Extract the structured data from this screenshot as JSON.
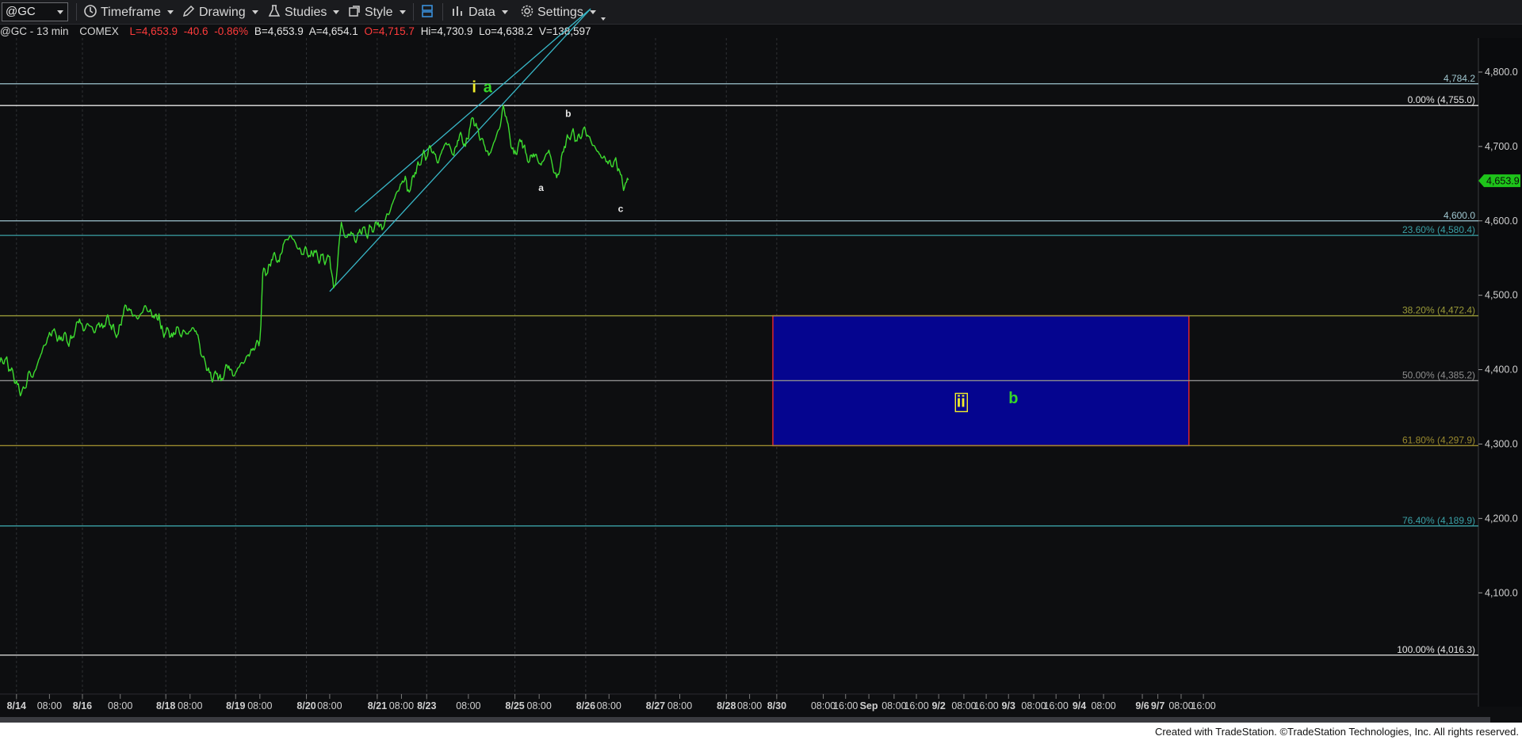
{
  "toolbar": {
    "symbol": "@GC",
    "timeframe_label": "Timeframe",
    "drawing_label": "Drawing",
    "studies_label": "Studies",
    "style_label": "Style",
    "data_label": "Data",
    "settings_label": "Settings"
  },
  "infobar": {
    "symbol_interval": "@GC - 13 min",
    "exchange": "COMEX",
    "last": "L=4,653.9",
    "change": "-40.6",
    "change_pct": "-0.86%",
    "bid": "B=4,653.9",
    "ask": "A=4,654.1",
    "open": "O=4,715.7",
    "high": "Hi=4,730.9",
    "low": "Lo=4,638.2",
    "volume": "V=138,597"
  },
  "footer": {
    "credit": "Created with TradeStation. ©TradeStation Technologies, Inc. All rights reserved."
  },
  "colors": {
    "background": "#0d0e10",
    "price_line": "#3ddc2f",
    "channel": "#38b8c8",
    "target_box_fill": "#05058f",
    "target_box_border": "#d0242f",
    "wave_yellow": "#f2ef2a",
    "wave_green": "#35d629"
  },
  "chart_data": {
    "type": "line",
    "title": "",
    "symbol": "@GC",
    "interval": "13 min",
    "ylim": [
      4000,
      4850
    ],
    "y_ticks": [
      "4,100.0",
      "4,200.0",
      "4,300.0",
      "4,400.0",
      "4,500.0",
      "4,600.0",
      "4,700.0",
      "4,800.0"
    ],
    "y_tick_values": [
      4100,
      4200,
      4300,
      4400,
      4500,
      4600,
      4700,
      4800
    ],
    "x_index_range": [
      0,
      1000
    ],
    "x_tick_labels": [
      {
        "i": 17,
        "label": "8/14"
      },
      {
        "i": 51,
        "label": "08:00"
      },
      {
        "i": 85,
        "label": "8/16"
      },
      {
        "i": 124,
        "label": "08:00"
      },
      {
        "i": 171,
        "label": "8/18"
      },
      {
        "i": 196,
        "label": "08:00"
      },
      {
        "i": 243,
        "label": "8/19"
      },
      {
        "i": 268,
        "label": "08:00"
      },
      {
        "i": 316,
        "label": "8/20"
      },
      {
        "i": 340,
        "label": "08:00"
      },
      {
        "i": 389,
        "label": "8/21"
      },
      {
        "i": 414,
        "label": "08:00"
      },
      {
        "i": 440,
        "label": "8/23"
      },
      {
        "i": 483,
        "label": "08:00"
      },
      {
        "i": 531,
        "label": "8/25"
      },
      {
        "i": 556,
        "label": "08:00"
      },
      {
        "i": 604,
        "label": "8/26"
      },
      {
        "i": 628,
        "label": "08:00"
      },
      {
        "i": 676,
        "label": "8/27"
      },
      {
        "i": 701,
        "label": "08:00"
      },
      {
        "i": 749,
        "label": "8/28"
      },
      {
        "i": 773,
        "label": "08:00"
      },
      {
        "i": 801,
        "label": "8/30"
      },
      {
        "i": 849,
        "label": "08:00"
      },
      {
        "i": 872,
        "label": "16:00"
      },
      {
        "i": 896,
        "label": "Sep"
      },
      {
        "i": 922,
        "label": "08:00"
      },
      {
        "i": 945,
        "label": "16:00"
      },
      {
        "i": 968,
        "label": "9/2"
      },
      {
        "i": 994,
        "label": "08:00"
      },
      {
        "i": 1017,
        "label": "16:00"
      },
      {
        "i": 1040,
        "label": "9/3"
      },
      {
        "i": 1066,
        "label": "08:00"
      },
      {
        "i": 1089,
        "label": "16:00"
      },
      {
        "i": 1113,
        "label": "9/4"
      },
      {
        "i": 1138,
        "label": "08:00"
      },
      {
        "i": 1178,
        "label": "9/6"
      },
      {
        "i": 1194,
        "label": "9/7"
      },
      {
        "i": 1218,
        "label": "08:00"
      },
      {
        "i": 1241,
        "label": "16:00"
      }
    ],
    "series": [
      {
        "values": [
          [
            0,
            4410
          ],
          [
            6,
            4415
          ],
          [
            10,
            4400
          ],
          [
            14,
            4392
          ],
          [
            18,
            4380
          ],
          [
            22,
            4368
          ],
          [
            26,
            4375
          ],
          [
            30,
            4398
          ],
          [
            34,
            4390
          ],
          [
            38,
            4405
          ],
          [
            42,
            4420
          ],
          [
            46,
            4433
          ],
          [
            50,
            4445
          ],
          [
            54,
            4452
          ],
          [
            58,
            4446
          ],
          [
            62,
            4440
          ],
          [
            66,
            4448
          ],
          [
            70,
            4435
          ],
          [
            74,
            4442
          ],
          [
            78,
            4456
          ],
          [
            82,
            4468
          ],
          [
            86,
            4452
          ],
          [
            90,
            4462
          ],
          [
            94,
            4458
          ],
          [
            98,
            4450
          ],
          [
            102,
            4463
          ],
          [
            106,
            4456
          ],
          [
            110,
            4470
          ],
          [
            114,
            4460
          ],
          [
            118,
            4452
          ],
          [
            122,
            4448
          ],
          [
            126,
            4470
          ],
          [
            130,
            4486
          ],
          [
            134,
            4480
          ],
          [
            138,
            4473
          ],
          [
            142,
            4468
          ],
          [
            146,
            4476
          ],
          [
            150,
            4486
          ],
          [
            154,
            4478
          ],
          [
            158,
            4472
          ],
          [
            162,
            4468
          ],
          [
            164,
            4475
          ],
          [
            166,
            4455
          ],
          [
            170,
            4448
          ],
          [
            174,
            4452
          ],
          [
            178,
            4444
          ],
          [
            182,
            4457
          ],
          [
            186,
            4446
          ],
          [
            190,
            4452
          ],
          [
            194,
            4448
          ],
          [
            198,
            4456
          ],
          [
            202,
            4452
          ],
          [
            205,
            4440
          ],
          [
            208,
            4418
          ],
          [
            212,
            4408
          ],
          [
            216,
            4396
          ],
          [
            220,
            4388
          ],
          [
            224,
            4395
          ],
          [
            228,
            4385
          ],
          [
            232,
            4400
          ],
          [
            236,
            4405
          ],
          [
            240,
            4392
          ],
          [
            244,
            4398
          ],
          [
            248,
            4408
          ],
          [
            252,
            4410
          ],
          [
            256,
            4420
          ],
          [
            260,
            4426
          ],
          [
            264,
            4435
          ],
          [
            267,
            4432
          ],
          [
            269,
            4460
          ],
          [
            271,
            4530
          ],
          [
            273,
            4535
          ],
          [
            276,
            4530
          ],
          [
            280,
            4548
          ],
          [
            284,
            4553
          ],
          [
            288,
            4545
          ],
          [
            292,
            4568
          ],
          [
            296,
            4575
          ],
          [
            300,
            4580
          ],
          [
            304,
            4572
          ],
          [
            308,
            4562
          ],
          [
            312,
            4555
          ],
          [
            316,
            4562
          ],
          [
            320,
            4552
          ],
          [
            324,
            4560
          ],
          [
            328,
            4548
          ],
          [
            332,
            4554
          ],
          [
            336,
            4545
          ],
          [
            340,
            4552
          ],
          [
            342,
            4530
          ],
          [
            344,
            4510
          ],
          [
            346,
            4515
          ],
          [
            348,
            4540
          ],
          [
            350,
            4575
          ],
          [
            352,
            4598
          ],
          [
            355,
            4580
          ],
          [
            358,
            4578
          ],
          [
            362,
            4585
          ],
          [
            366,
            4573
          ],
          [
            370,
            4584
          ],
          [
            374,
            4590
          ],
          [
            378,
            4580
          ],
          [
            382,
            4592
          ],
          [
            386,
            4590
          ],
          [
            390,
            4598
          ],
          [
            394,
            4588
          ],
          [
            398,
            4605
          ],
          [
            402,
            4612
          ],
          [
            406,
            4628
          ],
          [
            410,
            4640
          ],
          [
            414,
            4650
          ],
          [
            418,
            4660
          ],
          [
            420,
            4640
          ],
          [
            424,
            4648
          ],
          [
            428,
            4665
          ],
          [
            432,
            4675
          ],
          [
            436,
            4690
          ],
          [
            440,
            4685
          ],
          [
            444,
            4700
          ],
          [
            448,
            4690
          ],
          [
            452,
            4678
          ],
          [
            456,
            4695
          ],
          [
            460,
            4705
          ],
          [
            464,
            4700
          ],
          [
            468,
            4688
          ],
          [
            472,
            4708
          ],
          [
            476,
            4715
          ],
          [
            480,
            4700
          ],
          [
            484,
            4722
          ],
          [
            488,
            4738
          ],
          [
            492,
            4725
          ],
          [
            496,
            4710
          ],
          [
            500,
            4700
          ],
          [
            504,
            4688
          ],
          [
            508,
            4700
          ],
          [
            512,
            4715
          ],
          [
            516,
            4728
          ],
          [
            519,
            4755
          ],
          [
            522,
            4740
          ],
          [
            526,
            4710
          ],
          [
            530,
            4690
          ],
          [
            534,
            4698
          ],
          [
            538,
            4708
          ],
          [
            542,
            4692
          ],
          [
            546,
            4680
          ],
          [
            550,
            4690
          ],
          [
            554,
            4684
          ],
          [
            558,
            4675
          ],
          [
            562,
            4686
          ],
          [
            566,
            4695
          ],
          [
            570,
            4672
          ],
          [
            574,
            4658
          ],
          [
            578,
            4675
          ],
          [
            582,
            4700
          ],
          [
            586,
            4712
          ],
          [
            590,
            4720
          ],
          [
            594,
            4708
          ],
          [
            598,
            4712
          ],
          [
            602,
            4725
          ],
          [
            606,
            4715
          ],
          [
            610,
            4705
          ],
          [
            614,
            4698
          ],
          [
            618,
            4690
          ],
          [
            622,
            4685
          ],
          [
            626,
            4680
          ],
          [
            630,
            4675
          ],
          [
            634,
            4682
          ],
          [
            638,
            4670
          ],
          [
            640,
            4662
          ],
          [
            642,
            4650
          ],
          [
            644,
            4645
          ],
          [
            646,
            4652
          ],
          [
            648,
            4655
          ]
        ]
      }
    ],
    "last_price": "4,653.9",
    "horizontal_levels": [
      {
        "label": "4,784.2",
        "value": 4784.2
      },
      {
        "label": "0.00% (4,755.0)",
        "value": 4755.0
      },
      {
        "label": "4,600.0",
        "value": 4600.0
      },
      {
        "label": "23.60% (4,580.4)",
        "value": 4580.4
      },
      {
        "label": "38.20% (4,472.4)",
        "value": 4472.4
      },
      {
        "label": "50.00% (4,385.2)",
        "value": 4385.2
      },
      {
        "label": "61.80% (4,297.9)",
        "value": 4297.9
      },
      {
        "label": "76.40% (4,189.9)",
        "value": 4189.9
      },
      {
        "label": "100.00% (4,016.3)",
        "value": 4016.3
      }
    ],
    "channel": {
      "upper": [
        [
          366,
          4612
        ],
        [
          609,
          4885
        ]
      ],
      "lower": [
        [
          340,
          4505
        ],
        [
          609,
          4885
        ]
      ]
    },
    "target_box": {
      "x": [
        797,
        1226
      ],
      "y": [
        4297.9,
        4472.4
      ]
    },
    "annotations": [
      {
        "text": "i",
        "x": 489,
        "y": 4773,
        "color": "yellow",
        "size": "large"
      },
      {
        "text": "a",
        "x": 503,
        "y": 4773,
        "color": "green",
        "size": "large"
      },
      {
        "text": "b",
        "x": 586,
        "y": 4740,
        "color": "white",
        "size": "small"
      },
      {
        "text": "a",
        "x": 558,
        "y": 4640,
        "color": "white",
        "size": "small"
      },
      {
        "text": "c",
        "x": 640,
        "y": 4612,
        "color": "white",
        "size": "small"
      },
      {
        "text": "ii",
        "x": 991,
        "y": 4350,
        "color": "yellow",
        "size": "large",
        "boxed": true
      },
      {
        "text": "b",
        "x": 1045,
        "y": 4355,
        "color": "green",
        "size": "large"
      }
    ]
  }
}
